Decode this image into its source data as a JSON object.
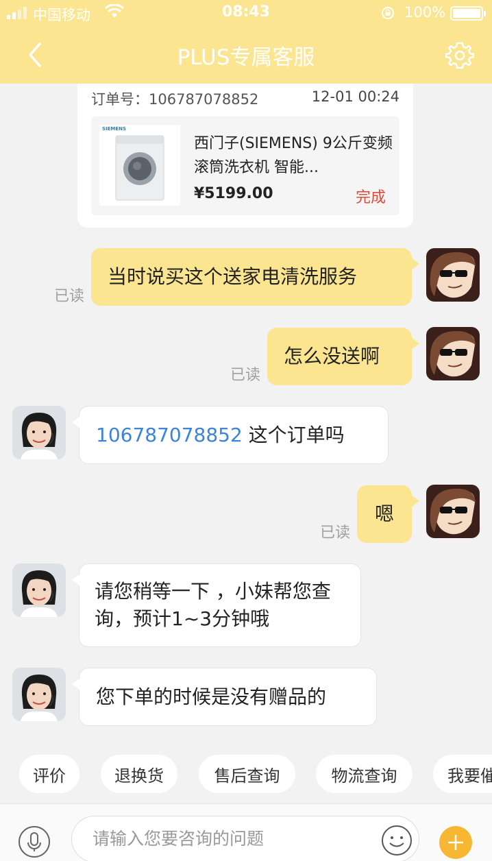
{
  "status_bar": {
    "carrier": "中国移动",
    "time": "08:43",
    "battery": "100%"
  },
  "header": {
    "title": "PLUS专属客服"
  },
  "order_card": {
    "label": "订单号：",
    "order_number": "106787078852",
    "time": "12-01 00:24",
    "product_brand": "SIEMENS",
    "product_name": "西门子(SIEMENS) 9公斤变频滚筒洗衣机 智能...",
    "price": "¥5199.00",
    "status": "完成"
  },
  "messages": [
    {
      "from": "user",
      "text": "当时说买这个送家电清洗服务",
      "read": "已读"
    },
    {
      "from": "user",
      "text": "怎么没送啊",
      "read": "已读"
    },
    {
      "from": "agent",
      "link_text": "106787078852",
      "text": " 这个订单吗"
    },
    {
      "from": "user",
      "text": "嗯",
      "read": "已读"
    },
    {
      "from": "agent",
      "text": "请您稍等一下 ，小妹帮您查询，预计1~3分钟哦"
    },
    {
      "from": "agent",
      "text": "您下单的时候是没有赠品的"
    }
  ],
  "quick_replies": [
    "评价",
    "退换货",
    "售后查询",
    "物流查询",
    "我要催"
  ],
  "input": {
    "placeholder": "请输入您要咨询的问题"
  },
  "colors": {
    "header": "#fbe591",
    "user_bubble": "#fbe591",
    "link": "#3b84d8",
    "status_done": "#e0493d",
    "plus_button": "#f7b733"
  }
}
